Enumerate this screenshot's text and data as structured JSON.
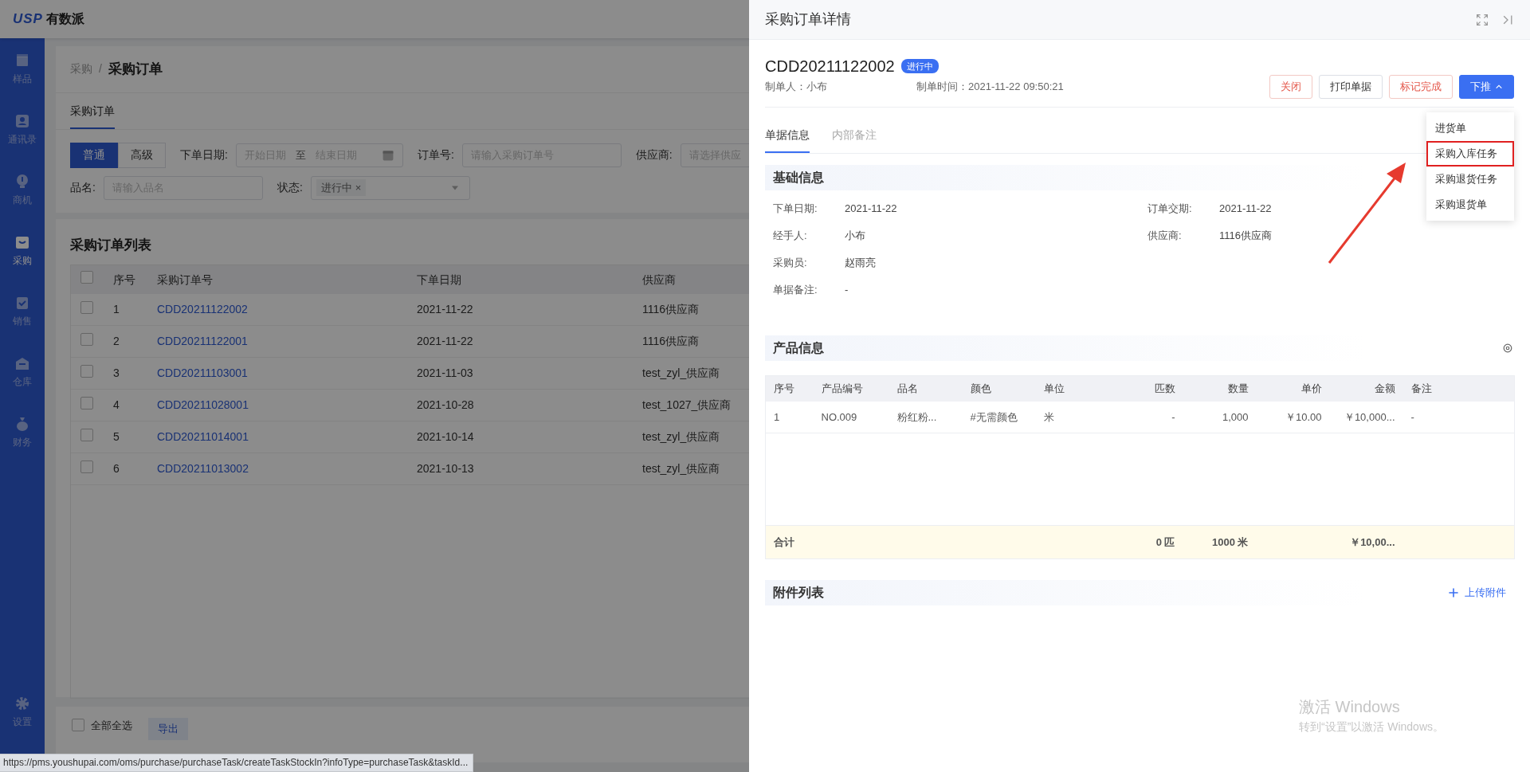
{
  "app": {
    "logo_mark": "USP",
    "logo_text": "有数派"
  },
  "sidebar": {
    "items": [
      {
        "label": "样品",
        "selected": false
      },
      {
        "label": "通讯录",
        "selected": false
      },
      {
        "label": "商机",
        "selected": false
      },
      {
        "label": "采购",
        "selected": true
      },
      {
        "label": "销售",
        "selected": false
      },
      {
        "label": "仓库",
        "selected": false
      },
      {
        "label": "财务",
        "selected": false
      }
    ],
    "bottom": {
      "label": "设置"
    }
  },
  "breadcrumb": {
    "items": [
      "采购",
      "采购订单"
    ],
    "separator": "/"
  },
  "page_tabs": [
    {
      "label": "采购订单",
      "selected": true
    }
  ],
  "filters": {
    "mode_toggle": [
      {
        "label": "普通",
        "selected": true
      },
      {
        "label": "高级",
        "selected": false
      }
    ],
    "date": {
      "label": "下单日期:",
      "start_placeholder": "开始日期",
      "separator": "至",
      "end_placeholder": "结束日期"
    },
    "order_no": {
      "label": "订单号:",
      "placeholder": "请输入采购订单号"
    },
    "supplier": {
      "label": "供应商:",
      "placeholder": "请选择供应"
    },
    "product": {
      "label": "品名:",
      "placeholder": "请输入品名"
    },
    "status": {
      "label": "状态:",
      "tags": [
        {
          "label": "进行中",
          "remove": "×"
        }
      ]
    }
  },
  "list": {
    "title": "采购订单列表",
    "all_checked": false,
    "columns": [
      "序号",
      "采购订单号",
      "下单日期",
      "供应商"
    ],
    "rows": [
      {
        "checked": false,
        "cells": [
          "1",
          "CDD20211122002",
          "2021-11-22",
          "1116供应商"
        ]
      },
      {
        "checked": false,
        "cells": [
          "2",
          "CDD20211122001",
          "2021-11-22",
          "1116供应商"
        ]
      },
      {
        "checked": false,
        "cells": [
          "3",
          "CDD20211103001",
          "2021-11-03",
          "test_zyl_供应商"
        ]
      },
      {
        "checked": false,
        "cells": [
          "4",
          "CDD20211028001",
          "2021-10-28",
          "test_1027_供应商"
        ]
      },
      {
        "checked": false,
        "cells": [
          "5",
          "CDD20211014001",
          "2021-10-14",
          "test_zyl_供应商"
        ]
      },
      {
        "checked": false,
        "cells": [
          "6",
          "CDD20211013002",
          "2021-10-13",
          "test_zyl_供应商"
        ]
      }
    ]
  },
  "footer": {
    "select_all": {
      "label": "全部全选",
      "checked": false
    },
    "export": "导出"
  },
  "status_url": "https://pms.youshupai.com/oms/purchase/purchaseTask/createTaskStockIn?infoType=purchaseTask&taskId...",
  "drawer": {
    "title": "采购订单详情",
    "order_no": "CDD20211122002",
    "status": "进行中",
    "meta": [
      "制单人：小布",
      "制单时间：2021-11-22 09:50:21"
    ],
    "buttons": [
      {
        "label": "关闭",
        "kind": "danger"
      },
      {
        "label": "打印单据",
        "kind": "default"
      },
      {
        "label": "标记完成",
        "kind": "danger"
      },
      {
        "label": "下推",
        "kind": "primary",
        "expanded": true
      }
    ],
    "dropdown": [
      {
        "label": "进货单",
        "highlighted": false
      },
      {
        "label": "采购入库任务",
        "highlighted": true
      },
      {
        "label": "采购退货任务",
        "highlighted": false
      },
      {
        "label": "采购退货单",
        "highlighted": false
      }
    ],
    "tabs": [
      {
        "label": "单据信息",
        "selected": true
      },
      {
        "label": "内部备注",
        "selected": false
      }
    ],
    "basic": {
      "title": "基础信息",
      "rows": [
        [
          {
            "label": "下单日期:",
            "value": "2021-11-22"
          },
          {
            "label": "订单交期:",
            "value": "2021-11-22"
          }
        ],
        [
          {
            "label": "经手人:",
            "value": "小布"
          },
          {
            "label": "供应商:",
            "value": "1116供应商"
          }
        ],
        [
          {
            "label": "采购员:",
            "value": "赵雨亮"
          }
        ],
        [
          {
            "label": "单据备注:",
            "value": "-"
          }
        ]
      ]
    },
    "products": {
      "title": "产品信息",
      "columns": [
        {
          "label": "序号",
          "kind": "text"
        },
        {
          "label": "产品编号",
          "kind": "text"
        },
        {
          "label": "品名",
          "kind": "text"
        },
        {
          "label": "颜色",
          "kind": "text"
        },
        {
          "label": "单位",
          "kind": "text"
        },
        {
          "label": "匹数",
          "kind": "number"
        },
        {
          "label": "数量",
          "kind": "number"
        },
        {
          "label": "单价",
          "kind": "number"
        },
        {
          "label": "金额",
          "kind": "number"
        },
        {
          "label": "备注",
          "kind": "text"
        }
      ],
      "rows": [
        [
          "1",
          "NO.009",
          "粉红粉...",
          "#无需颜色",
          "米",
          "-",
          "1,000",
          "￥10.00",
          "￥10,000...",
          "-"
        ]
      ],
      "totals": {
        "label": "合计",
        "pieces": "0 匹",
        "quantity": "1000 米",
        "amount": "￥10,00..."
      }
    },
    "attachments": {
      "title": "附件列表",
      "upload": "上传附件"
    }
  },
  "os_notice": [
    "激活 Windows",
    "转到“设置”以激活 Windows。"
  ]
}
